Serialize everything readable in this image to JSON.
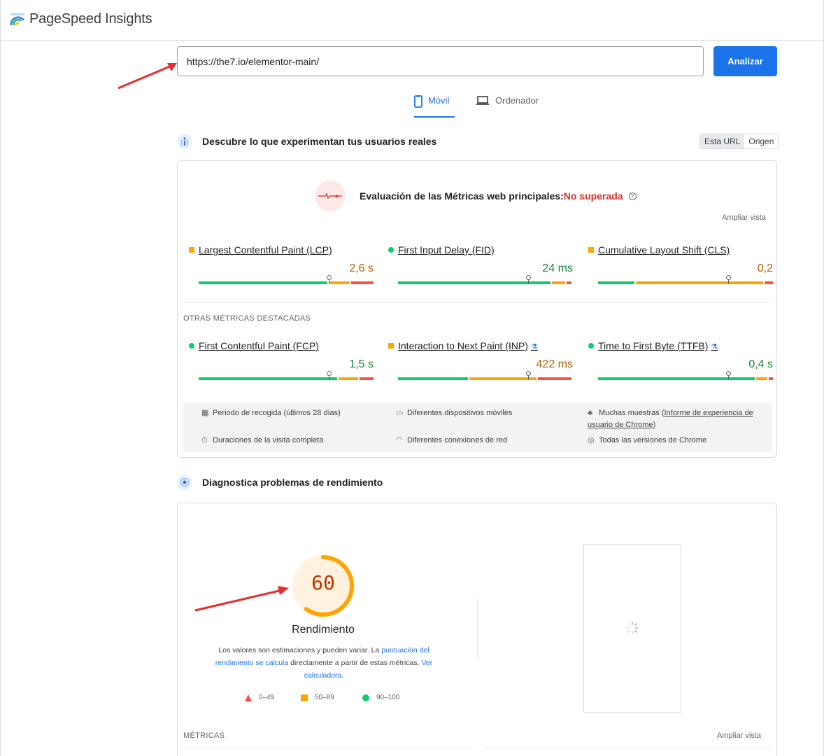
{
  "app": {
    "title": "PageSpeed Insights"
  },
  "search": {
    "url_value": "https://the7.io/elementor-main/",
    "analyze_label": "Analizar"
  },
  "tabs": {
    "mobile_label": "Móvil",
    "desktop_label": "Ordenador"
  },
  "field_section": {
    "heading": "Descubre lo que experimentan tus usuarios reales",
    "toggle": {
      "this_url": "Esta URL",
      "origin": "Origen"
    },
    "assessment": {
      "label": "Evaluación de las Métricas web principales:",
      "status": "No superada",
      "help": "?"
    },
    "expand_label": "Ampliar vista",
    "core_metrics": [
      {
        "name": "Largest Contentful Paint (LCP)",
        "value": "2,6 s",
        "rating": "average"
      },
      {
        "name": "First Input Delay (FID)",
        "value": "24 ms",
        "rating": "good"
      },
      {
        "name": "Cumulative Layout Shift (CLS)",
        "value": "0,2",
        "rating": "average"
      }
    ],
    "other_heading": "OTRAS MÉTRICAS DESTACADAS",
    "other_metrics": [
      {
        "name": "First Contentful Paint (FCP)",
        "value": "1,5 s",
        "rating": "good",
        "experimental": false
      },
      {
        "name": "Interaction to Next Paint (INP)",
        "value": "422 ms",
        "rating": "average",
        "experimental": true
      },
      {
        "name": "Time to First Byte (TTFB)",
        "value": "0,4 s",
        "rating": "good",
        "experimental": true
      }
    ],
    "info": {
      "period": "Periodo de recogida (últimos 28 días)",
      "devices": "Diferentes dispositivos móviles",
      "samples_prefix": "Muchas muestras (",
      "samples_link": "Informe de experiencia de usuario de Chrome",
      "samples_suffix": ")",
      "durations": "Duraciones de la visita completa",
      "connections": "Diferentes conexiones de red",
      "versions": "Todas las versiones de Chrome"
    }
  },
  "lab_section": {
    "heading": "Diagnostica problemas de rendimiento",
    "score": "60",
    "score_fraction": 0.6,
    "score_label": "Rendimiento",
    "note": {
      "part1": "Los valores son estimaciones y pueden variar. La ",
      "link1": "puntuación del rendimiento se calcula",
      "part2": " directamente a partir de estas métricas. ",
      "link2": "Ver calculadora",
      "part3": "."
    },
    "legend": {
      "poor": "0–49",
      "average": "50–89",
      "good": "90–100"
    },
    "metrics_heading": "MÉTRICAS",
    "expand_label": "Ampliar vista"
  },
  "colors": {
    "accent": "#1a73e8",
    "good": "#0cce6b",
    "average": "#ffa400",
    "poor": "#ff4e42",
    "fail_text": "#d93025"
  }
}
